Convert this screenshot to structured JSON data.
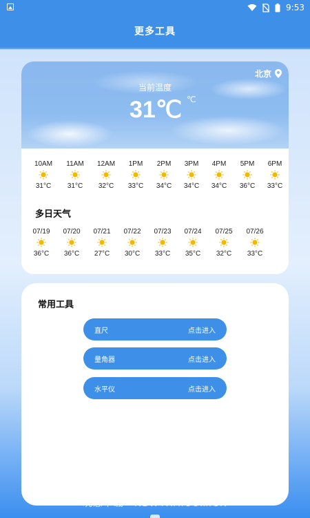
{
  "status_bar": {
    "time": "9:53"
  },
  "header": {
    "title": "更多工具"
  },
  "weather": {
    "city": "北京",
    "current_label": "当前温度",
    "current_temp": "31℃",
    "unit": "℃",
    "hourly": [
      {
        "time": "10AM",
        "icon": "sun-icon",
        "temp": "31°C"
      },
      {
        "time": "11AM",
        "icon": "sun-icon",
        "temp": "31°C"
      },
      {
        "time": "12AM",
        "icon": "sun-icon",
        "temp": "32°C"
      },
      {
        "time": "1PM",
        "icon": "sun-icon",
        "temp": "33°C"
      },
      {
        "time": "2PM",
        "icon": "sun-icon",
        "temp": "34°C"
      },
      {
        "time": "3PM",
        "icon": "sun-icon",
        "temp": "34°C"
      },
      {
        "time": "4PM",
        "icon": "sun-icon",
        "temp": "34°C"
      },
      {
        "time": "5PM",
        "icon": "sun-icon",
        "temp": "36°C"
      },
      {
        "time": "6PM",
        "icon": "sun-icon",
        "temp": "33°C"
      }
    ],
    "multi_day_title": "多日天气",
    "daily": [
      {
        "date": "07/19",
        "icon": "sun-icon",
        "temp": "36°C"
      },
      {
        "date": "07/20",
        "icon": "sun-icon",
        "temp": "36°C"
      },
      {
        "date": "07/21",
        "icon": "sun-icon",
        "temp": "27°C"
      },
      {
        "date": "07/22",
        "icon": "sun-icon",
        "temp": "30°C"
      },
      {
        "date": "07/23",
        "icon": "sun-icon",
        "temp": "33°C"
      },
      {
        "date": "07/24",
        "icon": "sun-icon",
        "temp": "35°C"
      },
      {
        "date": "07/25",
        "icon": "sun-icon",
        "temp": "32°C"
      },
      {
        "date": "07/26",
        "icon": "sun-icon",
        "temp": "33°C"
      }
    ]
  },
  "tools": {
    "title": "常用工具",
    "items": [
      {
        "name": "直尺",
        "action": "点击进入"
      },
      {
        "name": "量角器",
        "action": "点击进入"
      },
      {
        "name": "水平仪",
        "action": "点击进入"
      }
    ]
  },
  "watermark": "玩意下载 - NBWYXH.COM.CN",
  "colors": {
    "primary": "#3d8fe8",
    "sun": "#f5b800"
  }
}
